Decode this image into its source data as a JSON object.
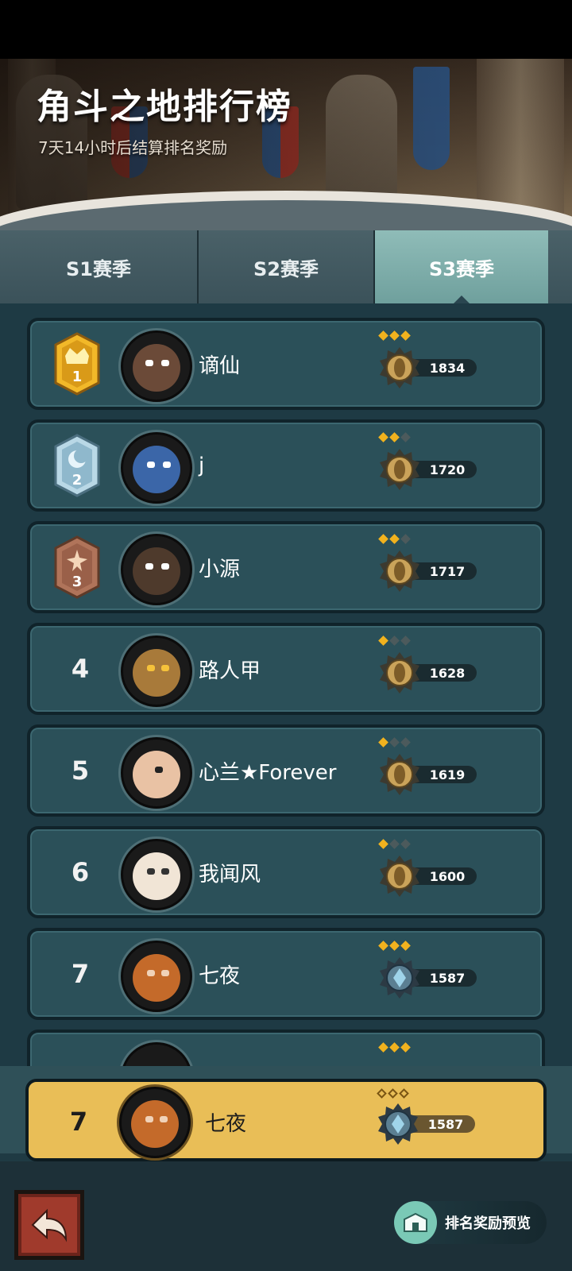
{
  "header": {
    "title": "角斗之地排行榜",
    "subtitle": "7天14小时后结算排名奖励"
  },
  "tabs": [
    {
      "label": "S1赛季",
      "active": false
    },
    {
      "label": "S2赛季",
      "active": false
    },
    {
      "label": "S3赛季",
      "active": true
    }
  ],
  "ranking": [
    {
      "rank": "1",
      "name": "谪仙",
      "score": "1834",
      "stars": 3,
      "badge": "gold-crown",
      "emblem": "gold"
    },
    {
      "rank": "2",
      "name": "j",
      "score": "1720",
      "stars": 2,
      "badge": "silver-moon",
      "emblem": "gold"
    },
    {
      "rank": "3",
      "name": "小源",
      "score": "1717",
      "stars": 2,
      "badge": "bronze-star",
      "emblem": "gold"
    },
    {
      "rank": "4",
      "name": "路人甲",
      "score": "1628",
      "stars": 1,
      "emblem": "gold"
    },
    {
      "rank": "5",
      "name": "心兰★Forever",
      "score": "1619",
      "stars": 1,
      "emblem": "gold"
    },
    {
      "rank": "6",
      "name": "我闻风",
      "score": "1600",
      "stars": 1,
      "emblem": "gold"
    },
    {
      "rank": "7",
      "name": "七夜",
      "score": "1587",
      "stars": 3,
      "emblem": "blue"
    }
  ],
  "self": {
    "rank": "7",
    "name": "七夜",
    "score": "1587",
    "stars": 3
  },
  "footer": {
    "back_icon": "return-arrow-icon",
    "preview_label": "排名奖励预览"
  },
  "colors": {
    "gold_row": "#e9be57",
    "row_bg": "#2b5059",
    "active_tab": "#8fbcb8",
    "star_on": "#f1b21e"
  }
}
